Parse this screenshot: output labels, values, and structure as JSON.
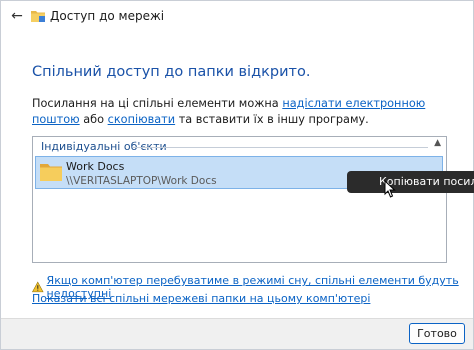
{
  "window": {
    "title": "Доступ до мережі",
    "back_glyph": "←"
  },
  "heading": "Спільний доступ до папки відкрито.",
  "description": {
    "part1": "Посилання на ці спільні елементи можна ",
    "email_link": "надіслати електронною поштою",
    "part2": " або ",
    "copy_link": "скопіювати",
    "part3": " та вставити їх в іншу програму."
  },
  "list": {
    "group_header": "Індивідуальні об'єкти",
    "items": [
      {
        "name": "Work Docs",
        "path": "\\\\VERITASLAPTOP\\Work Docs"
      }
    ]
  },
  "tooltip": "Копіювати посилання",
  "warning_link": "Якщо комп'ютер перебуватиме в режимі сну, спільні елементи будуть недоступні",
  "show_shares_link": "Показати всі спільні мережеві папки на цьому комп'ютері",
  "footer": {
    "done_label": "Готово"
  },
  "colors": {
    "accent": "#0b63c5",
    "heading": "#1a52a8",
    "selection": "#c5def7"
  }
}
